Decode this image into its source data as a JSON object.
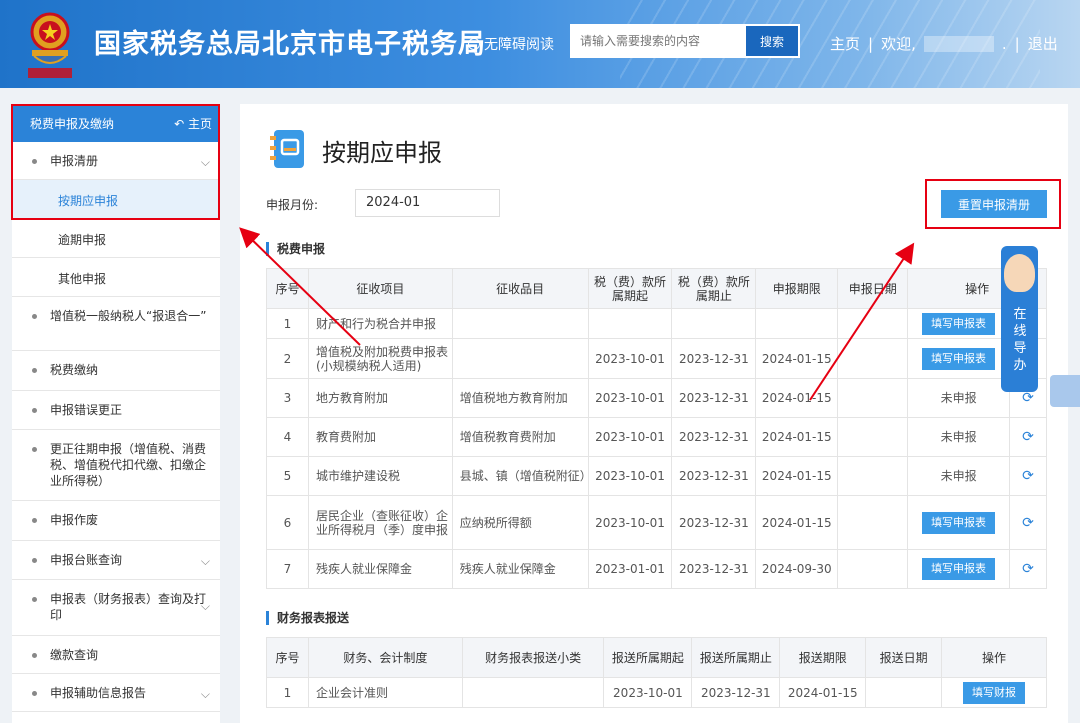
{
  "header": {
    "site_title": "国家税务总局北京市电子税务局",
    "accessibility_label": "无障碍阅读",
    "search_placeholder": "请输入需要搜索的内容",
    "search_button": "搜索",
    "nav_home": "主页",
    "nav_sep1": "|",
    "welcome": "欢迎,",
    "welcome_suffix": ".",
    "nav_sep2": "|",
    "logout": "退出"
  },
  "sidebar": {
    "header_label": "税费申报及缴纳",
    "home_label": "主页",
    "items": [
      {
        "label": "申报清册",
        "expandable": true
      },
      {
        "label": "增值税一般纳税人“报退合一”",
        "expandable": false
      },
      {
        "label": "税费缴纳",
        "expandable": false
      },
      {
        "label": "申报错误更正",
        "expandable": false
      },
      {
        "label": "更正往期申报（增值税、消费税、增值税代扣代缴、扣缴企业所得税）",
        "expandable": false
      },
      {
        "label": "申报作废",
        "expandable": false
      },
      {
        "label": "申报台账查询",
        "expandable": true
      },
      {
        "label": "申报表（财务报表）查询及打印",
        "expandable": true
      },
      {
        "label": "缴款查询",
        "expandable": false
      },
      {
        "label": "申报辅助信息报告",
        "expandable": true
      }
    ],
    "sub_items": [
      "按期应申报",
      "逾期申报",
      "其他申报"
    ]
  },
  "main": {
    "page_title": "按期应申报",
    "month_label": "申报月份:",
    "month_value": "2024-01",
    "reset_button": "重置申报清册",
    "tax_section_title": "税费申报",
    "tax_headers": [
      "序号",
      "征收项目",
      "征收品目",
      "税（费）款所属期起",
      "税（费）款所属期止",
      "申报期限",
      "申报日期",
      "操作"
    ],
    "tax_rows": [
      {
        "no": "1",
        "item": "财产和行为税合并申报",
        "sub": "",
        "start": "",
        "end": "",
        "deadline": "",
        "date": "",
        "op": "填写申报表",
        "op_type": "button",
        "refresh": false
      },
      {
        "no": "2",
        "item": "增值税及附加税费申报表(小规模纳税人适用)",
        "sub": "",
        "start": "2023-10-01",
        "end": "2023-12-31",
        "deadline": "2024-01-15",
        "date": "",
        "op": "填写申报表",
        "op_type": "button",
        "refresh": false
      },
      {
        "no": "3",
        "item": "地方教育附加",
        "sub": "增值税地方教育附加",
        "start": "2023-10-01",
        "end": "2023-12-31",
        "deadline": "2024-01-15",
        "date": "",
        "op": "未申报",
        "op_type": "text",
        "refresh": true
      },
      {
        "no": "4",
        "item": "教育费附加",
        "sub": "增值税教育费附加",
        "start": "2023-10-01",
        "end": "2023-12-31",
        "deadline": "2024-01-15",
        "date": "",
        "op": "未申报",
        "op_type": "text",
        "refresh": true
      },
      {
        "no": "5",
        "item": "城市维护建设税",
        "sub": "县城、镇（增值税附征）",
        "start": "2023-10-01",
        "end": "2023-12-31",
        "deadline": "2024-01-15",
        "date": "",
        "op": "未申报",
        "op_type": "text",
        "refresh": true
      },
      {
        "no": "6",
        "item": "居民企业（查账征收）企业所得税月（季）度申报",
        "sub": "应纳税所得额",
        "start": "2023-10-01",
        "end": "2023-12-31",
        "deadline": "2024-01-15",
        "date": "",
        "op": "填写申报表",
        "op_type": "button",
        "refresh": true
      },
      {
        "no": "7",
        "item": "残疾人就业保障金",
        "sub": "残疾人就业保障金",
        "start": "2023-01-01",
        "end": "2023-12-31",
        "deadline": "2024-09-30",
        "date": "",
        "op": "填写申报表",
        "op_type": "button",
        "refresh": true
      }
    ],
    "fin_section_title": "财务报表报送",
    "fin_headers": [
      "序号",
      "财务、会计制度",
      "财务报表报送小类",
      "报送所属期起",
      "报送所属期止",
      "报送期限",
      "报送日期",
      "操作"
    ],
    "fin_rows": [
      {
        "no": "1",
        "system": "企业会计准则",
        "sub": "",
        "start": "2023-10-01",
        "end": "2023-12-31",
        "deadline": "2024-01-15",
        "date": "",
        "op": "填写财报"
      }
    ]
  },
  "guide": {
    "text": "在线导办"
  },
  "colors": {
    "accent": "#2b83d8",
    "button": "#3a9ae6",
    "highlight": "#e60012"
  }
}
